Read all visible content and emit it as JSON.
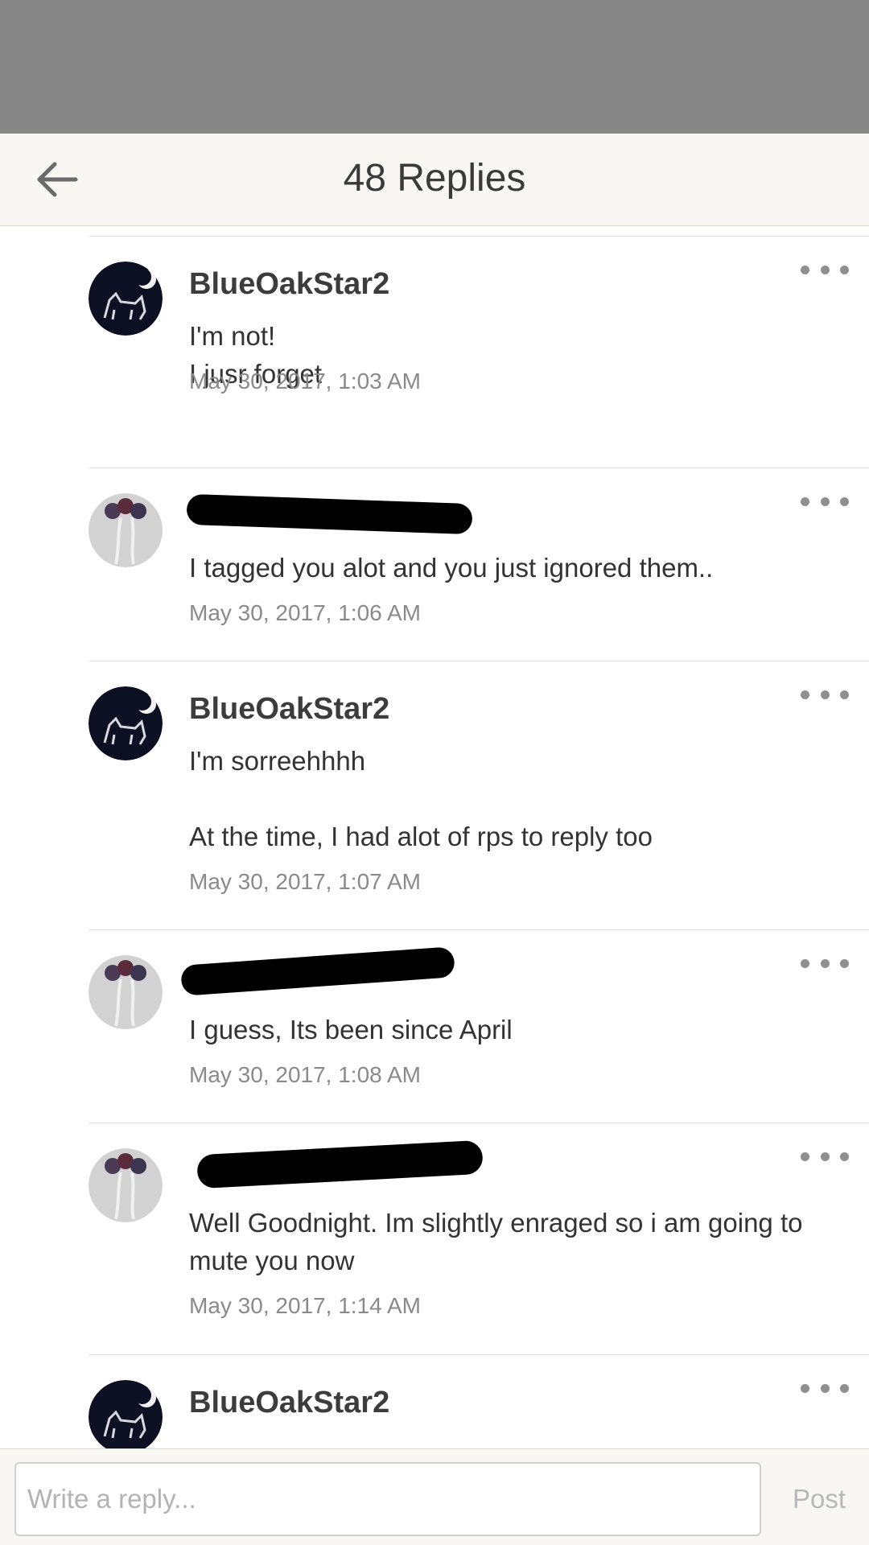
{
  "header": {
    "title": "48 Replies",
    "back_icon": "arrow-left-icon"
  },
  "comments": [
    {
      "author": "BlueOakStar2",
      "avatar": "moon-cat-avatar",
      "body": [
        "I'm not!",
        "I jusr forget"
      ],
      "timestamp": "May 30, 2017, 1:03 AM",
      "author_redacted": false
    },
    {
      "author": "",
      "avatar": "flower-crown-avatar",
      "body": [
        "I tagged you alot and you just ignored them.."
      ],
      "timestamp": "May 30, 2017, 1:06 AM",
      "author_redacted": true
    },
    {
      "author": "BlueOakStar2",
      "avatar": "moon-cat-avatar",
      "body": [
        "I'm sorreehhhh",
        "",
        "At the time, I had alot of rps to reply too"
      ],
      "timestamp": "May 30, 2017, 1:07 AM",
      "author_redacted": false
    },
    {
      "author": "",
      "avatar": "flower-crown-avatar",
      "body": [
        "I guess, Its been since April"
      ],
      "timestamp": "May 30, 2017, 1:08 AM",
      "author_redacted": true
    },
    {
      "author": "",
      "avatar": "flower-crown-avatar",
      "body": [
        "Well Goodnight. Im slightly enraged so i am going to mute you now"
      ],
      "timestamp": "May 30, 2017, 1:14 AM",
      "author_redacted": true
    },
    {
      "author": "BlueOakStar2",
      "avatar": "moon-cat-avatar",
      "body": [],
      "timestamp": "",
      "author_redacted": false
    }
  ],
  "reply_bar": {
    "placeholder": "Write a reply...",
    "post_label": "Post"
  },
  "colors": {
    "status_area": "#868686",
    "header_bg": "#f8f7f3",
    "divider": "#e1e1e1",
    "more_dots": "#8f8f8f",
    "timestamp": "#8a8a8a"
  }
}
